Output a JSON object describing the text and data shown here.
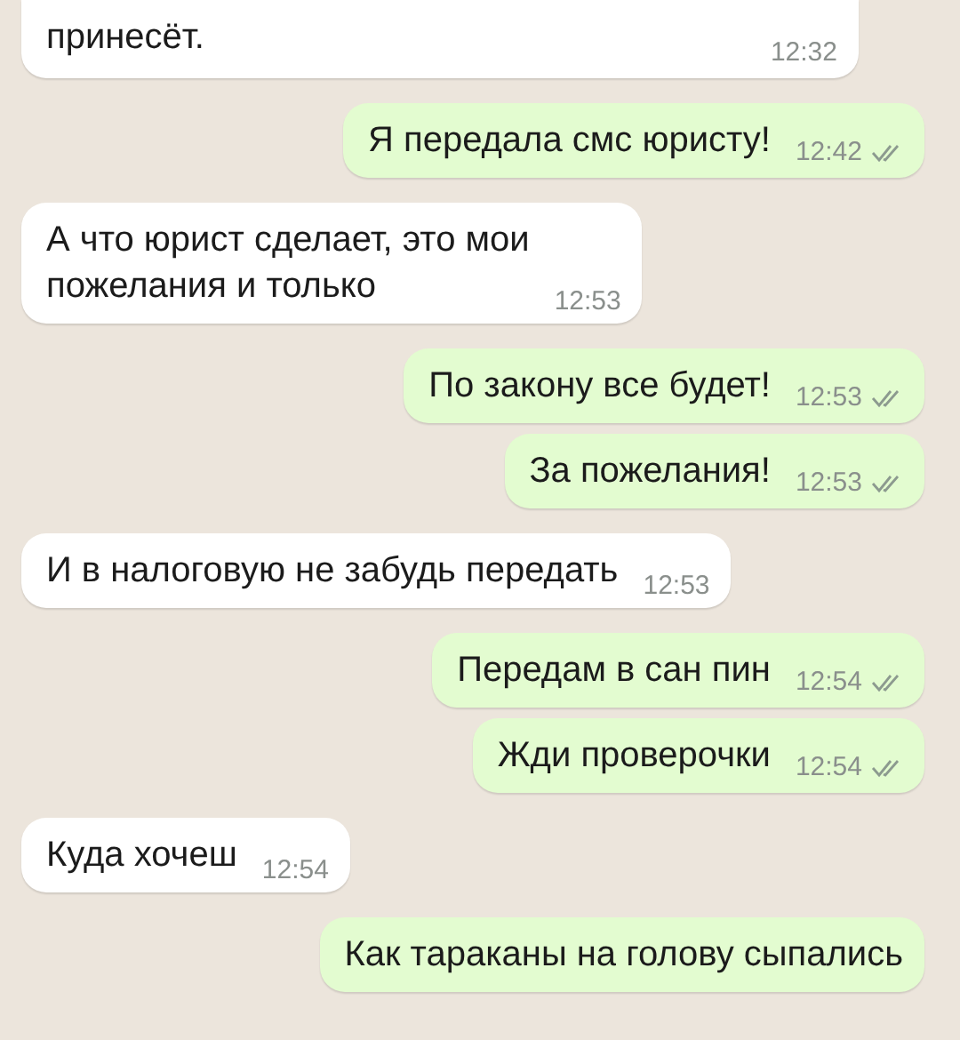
{
  "messages": [
    {
      "kind": "incoming",
      "text": "принесёт.",
      "time": "12:32"
    },
    {
      "kind": "outgoing",
      "text": "Я передала смс юристу!",
      "time": "12:42",
      "read": false
    },
    {
      "kind": "incoming",
      "text": "А что юрист сделает, это мои\nпожелания и только",
      "time": "12:53"
    },
    {
      "kind": "outgoing",
      "text": "По закону все будет!",
      "time": "12:53",
      "read": false
    },
    {
      "kind": "outgoing",
      "text": "За пожелания!",
      "time": "12:53",
      "read": false
    },
    {
      "kind": "incoming",
      "text": "И в налоговую не забудь передать",
      "time": "12:53"
    },
    {
      "kind": "outgoing",
      "text": "Передам в сан пин",
      "time": "12:54",
      "read": false
    },
    {
      "kind": "outgoing",
      "text": "Жди проверочки",
      "time": "12:54",
      "read": false
    },
    {
      "kind": "incoming",
      "text": "Куда хочеш",
      "time": "12:54"
    },
    {
      "kind": "outgoing",
      "text": "Как тараканы на голову сыпались"
    }
  ]
}
